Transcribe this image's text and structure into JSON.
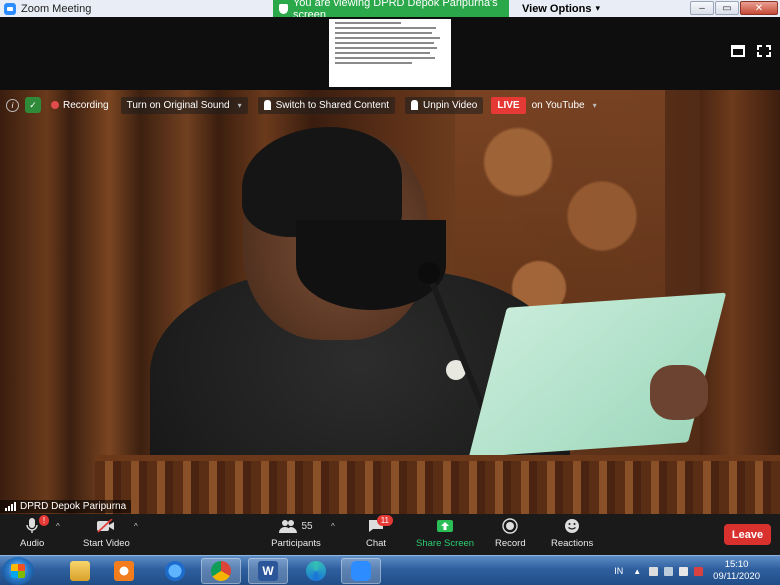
{
  "window": {
    "title": "Zoom Meeting"
  },
  "share_banner": {
    "text": "You are viewing DPRD Depok Paripurna's screen"
  },
  "view_options": {
    "label": "View Options"
  },
  "overlay": {
    "recording_label": "Recording",
    "original_sound_label": "Turn on Original Sound",
    "switch_shared_label": "Switch to Shared Content",
    "unpin_label": "Unpin Video",
    "live_badge": "LIVE",
    "youtube_label": "on YouTube"
  },
  "participant": {
    "name": "DPRD Depok Paripurna"
  },
  "toolbar": {
    "audio_label": "Audio",
    "audio_badge": "!",
    "start_video_label": "Start Video",
    "participants_label": "Participants",
    "participants_count": "55",
    "chat_label": "Chat",
    "chat_badge": "11",
    "share_screen_label": "Share Screen",
    "record_label": "Record",
    "reactions_label": "Reactions",
    "leave_label": "Leave"
  },
  "taskbar": {
    "language": "IN",
    "time": "15:10",
    "date": "09/11/2020"
  },
  "colors": {
    "share_banner": "#2aa84a",
    "live": "#e53935",
    "leave": "#d9322e",
    "share_screen_accent": "#2ecc71"
  }
}
